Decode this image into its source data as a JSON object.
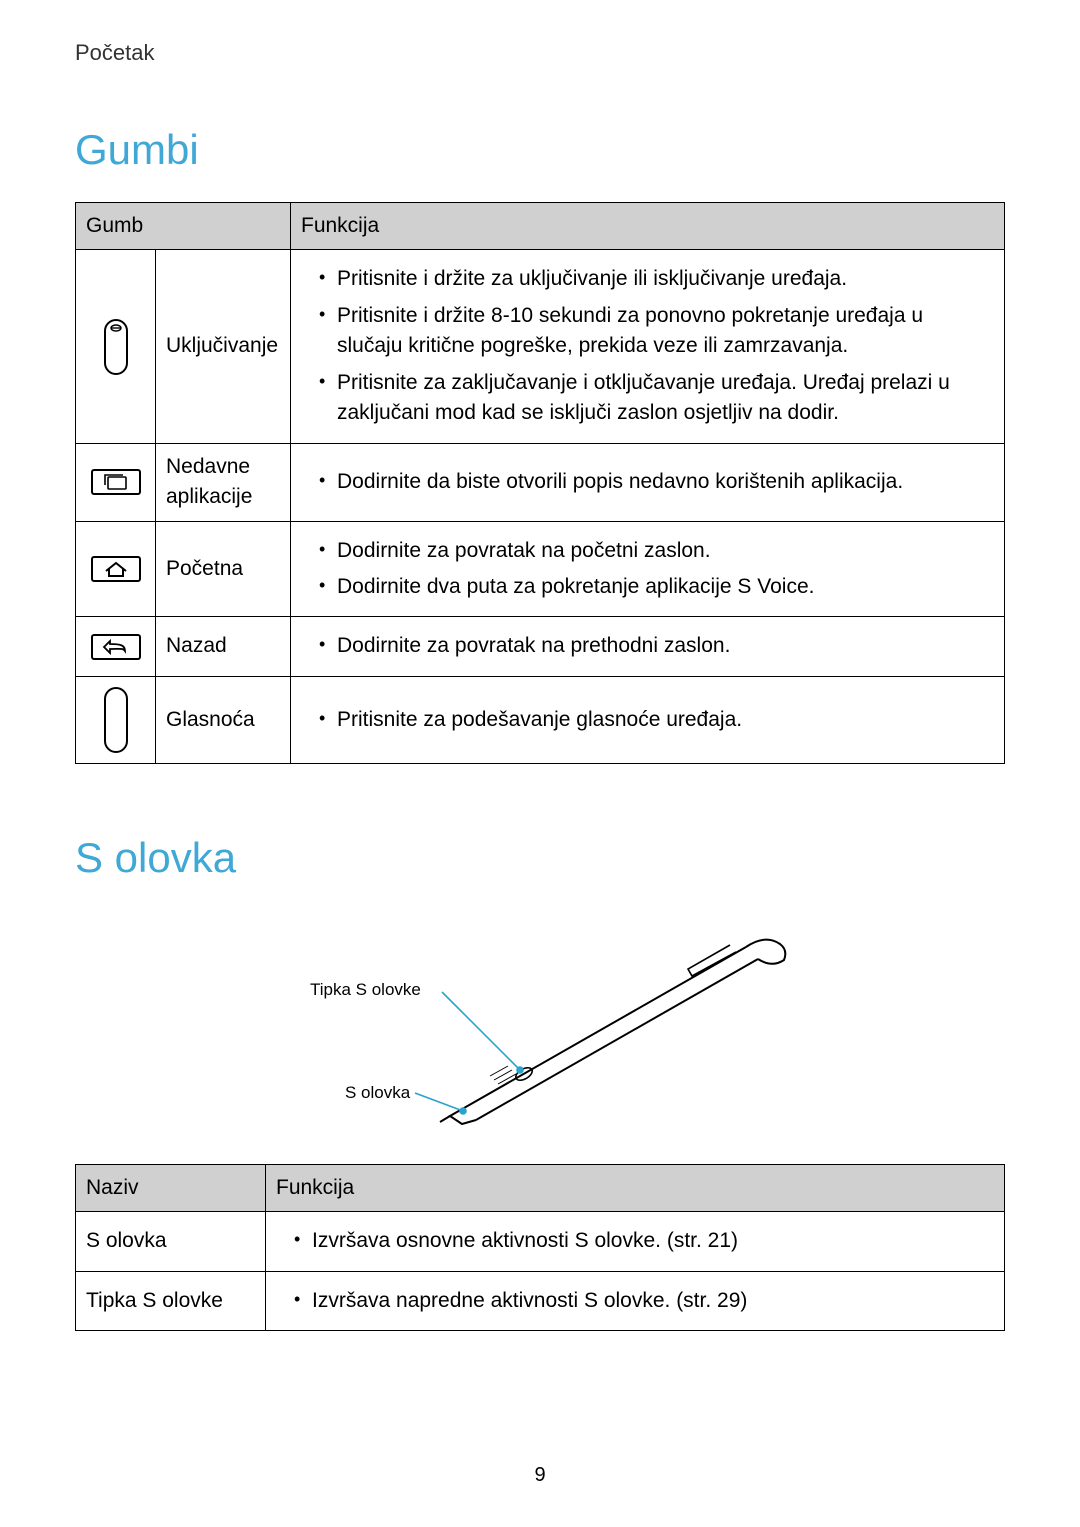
{
  "header": {
    "section": "Početak"
  },
  "gumbi": {
    "title": "Gumbi",
    "col1": "Gumb",
    "col2": "Funkcija",
    "rows": [
      {
        "label": "Uključivanje",
        "funcs": [
          "Pritisnite i držite za uključivanje ili isključivanje uređaja.",
          "Pritisnite i držite 8-10 sekundi za ponovno pokretanje uređaja u slučaju kritične pogreške, prekida veze ili zamrzavanja.",
          "Pritisnite za zaključavanje i otključavanje uređaja. Uređaj prelazi u zaključani mod kad se isključi zaslon osjetljiv na dodir."
        ]
      },
      {
        "label": "Nedavne aplikacije",
        "funcs": [
          "Dodirnite da biste otvorili popis nedavno korištenih aplikacija."
        ]
      },
      {
        "label": "Početna",
        "funcs": [
          "Dodirnite za povratak na početni zaslon.",
          "Dodirnite dva puta za pokretanje aplikacije S Voice."
        ]
      },
      {
        "label": "Nazad",
        "funcs": [
          "Dodirnite za povratak na prethodni zaslon."
        ]
      },
      {
        "label": "Glasnoća",
        "funcs": [
          "Pritisnite za podešavanje glasnoće uređaja."
        ]
      }
    ]
  },
  "solovka": {
    "title": "S olovka",
    "diagram": {
      "label1": "Tipka S olovke",
      "label2": "S olovka"
    },
    "table": {
      "col1": "Naziv",
      "col2": "Funkcija",
      "rows": [
        {
          "name": "S olovka",
          "func": "Izvršava osnovne aktivnosti S olovke. (str. 21)"
        },
        {
          "name": "Tipka S olovke",
          "func": "Izvršava napredne aktivnosti S olovke. (str. 29)"
        }
      ]
    }
  },
  "page_number": "9"
}
